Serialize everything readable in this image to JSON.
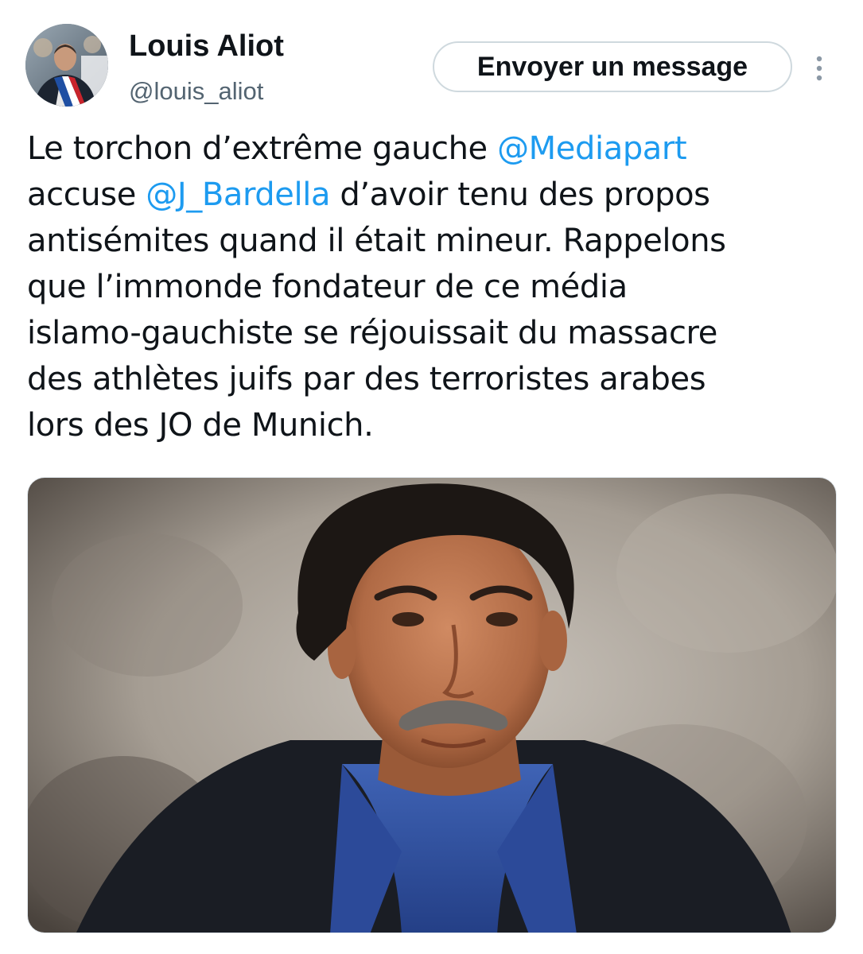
{
  "author": {
    "display_name": "Louis Aliot",
    "handle": "@louis_aliot",
    "avatar_icon": "profile-photo"
  },
  "actions": {
    "message_button_label": "Envoyer un message",
    "more_icon": "vertical-ellipsis-icon"
  },
  "tweet": {
    "lines": [
      {
        "parts": [
          {
            "text": "Le torchon d’extrême gauche "
          },
          {
            "text": "@Mediapart",
            "mention": true
          }
        ]
      },
      {
        "parts": [
          {
            "text": "accuse "
          },
          {
            "text": "@J_Bardella",
            "mention": true
          },
          {
            "text": " d’avoir tenu des propos"
          }
        ]
      },
      {
        "parts": [
          {
            "text": "antisémites quand il était mineur. Rappelons"
          }
        ]
      },
      {
        "parts": [
          {
            "text": "que l’immonde fondateur de ce média"
          }
        ]
      },
      {
        "parts": [
          {
            "text": "islamo-gauchiste se réjouissait du massacre"
          }
        ]
      },
      {
        "parts": [
          {
            "text": "des athlètes juifs par des terroristes arabes"
          }
        ]
      },
      {
        "parts": [
          {
            "text": "lors des JO de Munich."
          }
        ]
      }
    ]
  },
  "media": {
    "type": "photo",
    "subject": "portrait-photo"
  },
  "colors": {
    "mention": "#1d9bf0",
    "text": "#0f1419",
    "secondary": "#536471",
    "border": "#cfd9de"
  }
}
